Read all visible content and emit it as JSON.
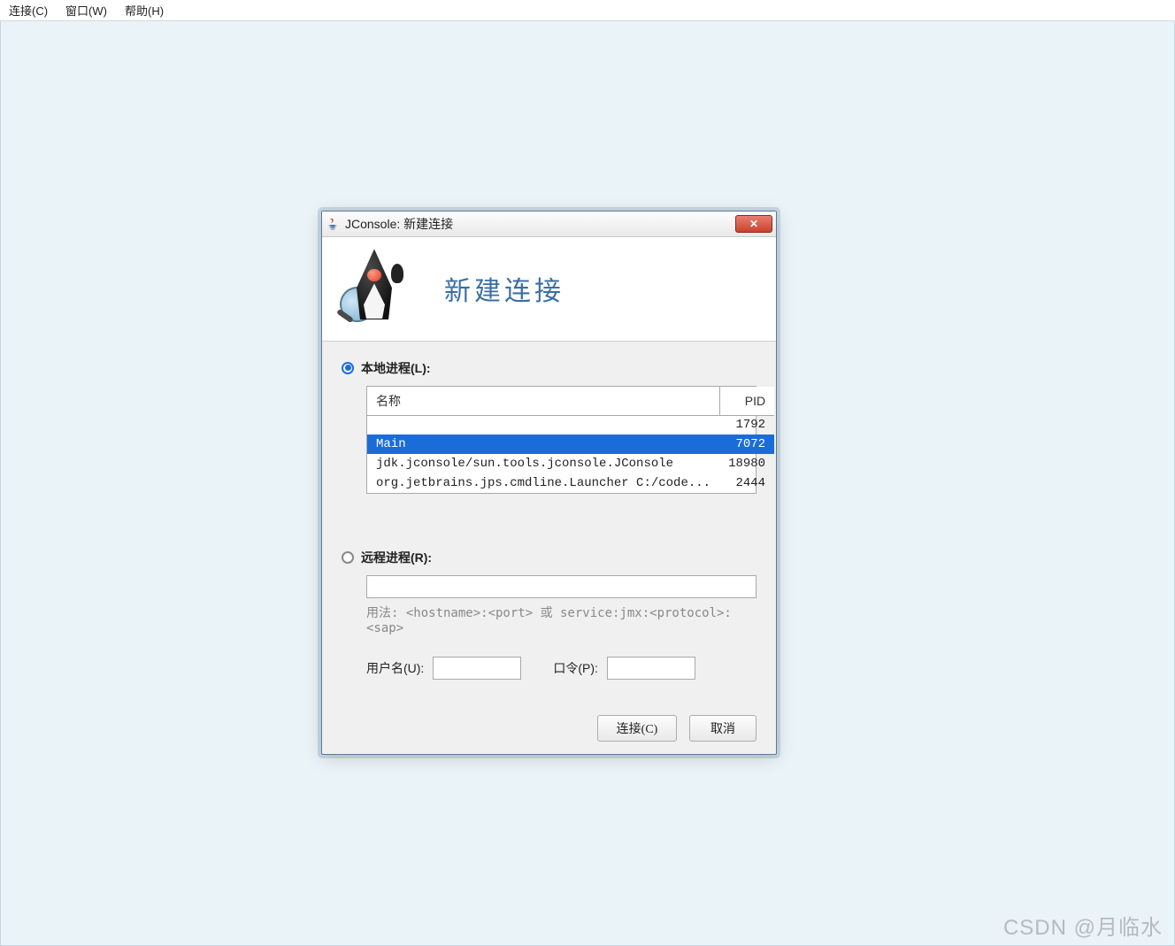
{
  "menubar": {
    "connect": "连接(C)",
    "window": "窗口(W)",
    "help": "帮助(H)"
  },
  "dialog": {
    "title": "JConsole: 新建连接",
    "headerTitle": "新建连接",
    "local": {
      "label": "本地进程(L):",
      "columns": {
        "name": "名称",
        "pid": "PID"
      },
      "rows": [
        {
          "name": "",
          "pid": "1792",
          "selected": false
        },
        {
          "name": "Main",
          "pid": "7072",
          "selected": true
        },
        {
          "name": "jdk.jconsole/sun.tools.jconsole.JConsole",
          "pid": "18980",
          "selected": false
        },
        {
          "name": "org.jetbrains.jps.cmdline.Launcher C:/code...",
          "pid": "2444",
          "selected": false
        }
      ]
    },
    "remote": {
      "label": "远程进程(R):",
      "value": "",
      "usage": "用法: <hostname>:<port> 或 service:jmx:<protocol>:<sap>"
    },
    "credentials": {
      "userLabel": "用户名(U):",
      "userValue": "",
      "passLabel": "口令(P):",
      "passValue": ""
    },
    "buttons": {
      "connect": "连接(C)",
      "cancel": "取消"
    }
  },
  "watermark": "CSDN @月临水"
}
